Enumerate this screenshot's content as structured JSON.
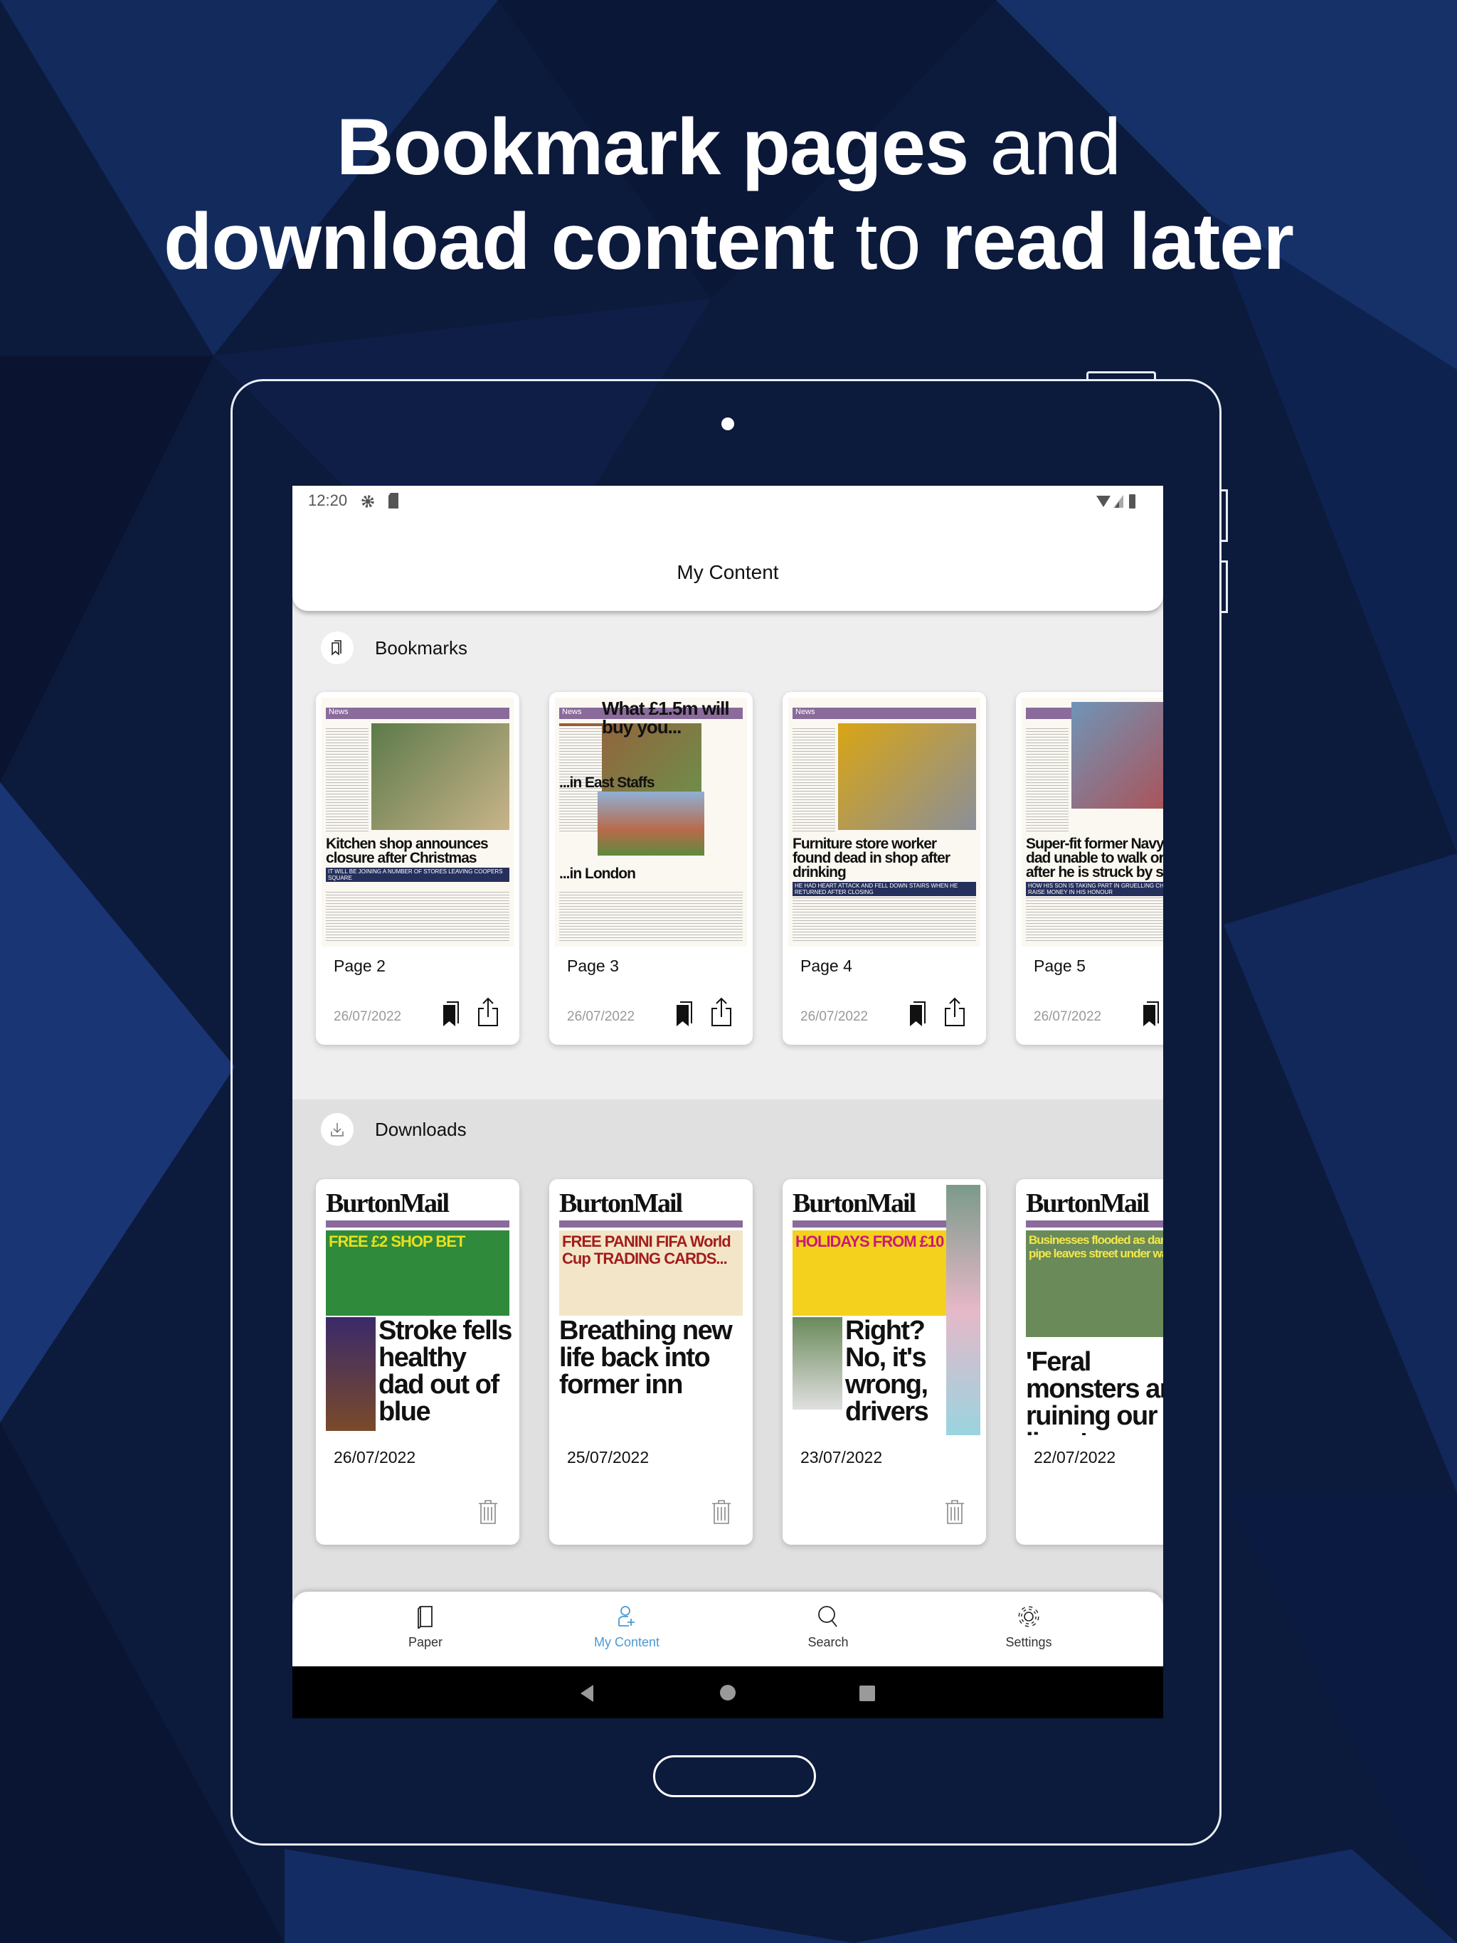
{
  "promo": {
    "line1_bold1": "Bookmark pages",
    "line1_reg": " and",
    "line2_bold1": "download content",
    "line2_reg": " to ",
    "line2_bold2": "read later"
  },
  "status_bar": {
    "time": "12:20"
  },
  "app_bar": {
    "title": "My Content"
  },
  "bookmarks": {
    "title": "Bookmarks",
    "items": [
      {
        "page": "Page 2",
        "date": "26/07/2022",
        "headline": "Kitchen shop announces closure after Christmas",
        "section": "News",
        "sub": "IT WILL BE JOINING A NUMBER OF STORES LEAVING COOPERS SQUARE"
      },
      {
        "page": "Page 3",
        "date": "26/07/2022",
        "headline": "What £1.5m will buy you...",
        "section": "News",
        "sub": "...in East Staffs",
        "sub2": "...in London"
      },
      {
        "page": "Page 4",
        "date": "26/07/2022",
        "headline": "Furniture store worker found dead in shop after drinking",
        "section": "News",
        "sub": "HE HAD HEART ATTACK AND FELL DOWN STAIRS WHEN HE RETURNED AFTER CLOSING"
      },
      {
        "page": "Page 5",
        "date": "26/07/2022",
        "headline": "Super-fit former Navy diver dad unable to walk or talk after he is struck by stroke",
        "section": "",
        "sub": "HOW HIS SON IS TAKING PART IN GRUELLING CHALLENGE TO RAISE MONEY IN HIS HONOUR"
      }
    ]
  },
  "downloads": {
    "title": "Downloads",
    "masthead": "BurtonMail",
    "items": [
      {
        "date": "26/07/2022",
        "promo": "FREE £2 SHOP BET",
        "headline": "Stroke fells healthy dad out of blue"
      },
      {
        "date": "25/07/2022",
        "promo": "FREE PANINI FIFA World Cup TRADING CARDS...",
        "headline": "Breathing new life back into former inn"
      },
      {
        "date": "23/07/2022",
        "promo": "HOLIDAYS FROM £10",
        "headline": "Right? No, it's wrong, drivers"
      },
      {
        "date": "22/07/2022",
        "promo": "Businesses flooded as damage to pipe leaves street under water",
        "headline": "'Feral monsters are ruining our lives'"
      }
    ]
  },
  "bottom_nav": {
    "items": [
      {
        "label": "Paper",
        "icon": "paper-icon"
      },
      {
        "label": "My Content",
        "icon": "my-content-icon",
        "active": true
      },
      {
        "label": "Search",
        "icon": "search-icon"
      },
      {
        "label": "Settings",
        "icon": "gear-icon"
      }
    ],
    "active_color": "#4a9ad4"
  },
  "colors": {
    "background": "#0b1838",
    "section_bookmarks": "#eeeeee",
    "section_downloads": "#e0e0e0",
    "accent": "#4a9ad4"
  }
}
